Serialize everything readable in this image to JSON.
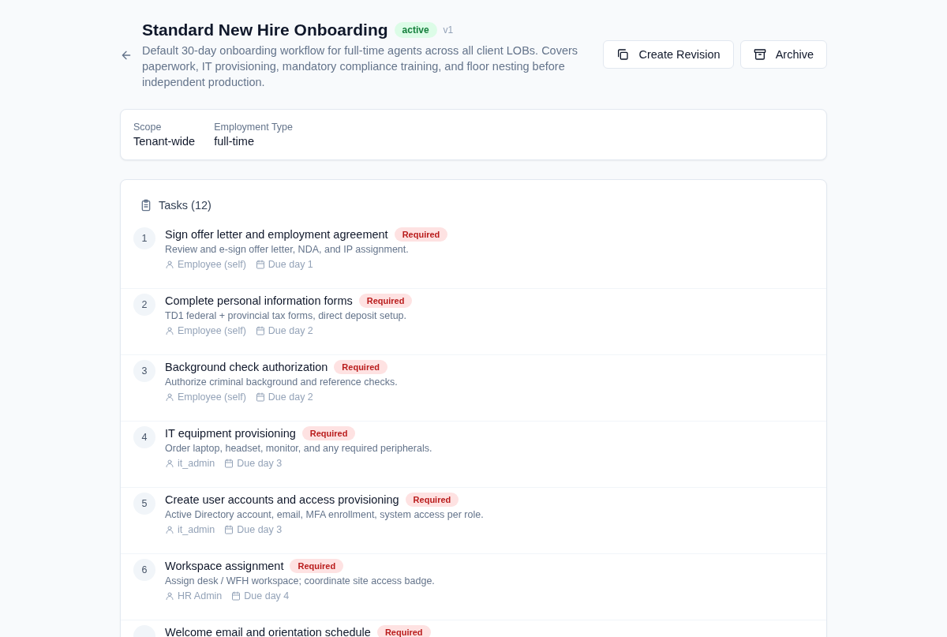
{
  "header": {
    "title": "Standard New Hire Onboarding",
    "status": "active",
    "version": "v1",
    "description": "Default 30-day onboarding workflow for full-time agents across all client LOBs. Covers paperwork, IT provisioning, mandatory compliance training, and floor nesting before independent production."
  },
  "actions": [
    {
      "label": "Create Revision",
      "kind": "copy"
    },
    {
      "label": "Archive",
      "kind": "archive"
    }
  ],
  "details": [
    {
      "label": "Scope",
      "value": "Tenant-wide"
    },
    {
      "label": "Employment Type",
      "value": "full-time"
    }
  ],
  "tasks": {
    "heading": "Tasks (12)",
    "items": [
      {
        "number": "1",
        "title": "Sign offer letter and employment agreement",
        "badge": "Required",
        "description": "Review and e-sign offer letter, NDA, and IP assignment.",
        "assignee": "Employee (self)",
        "due": "Due day 1"
      },
      {
        "number": "2",
        "title": "Complete personal information forms",
        "badge": "Required",
        "description": "TD1 federal + provincial tax forms, direct deposit setup.",
        "assignee": "Employee (self)",
        "due": "Due day 2"
      },
      {
        "number": "3",
        "title": "Background check authorization",
        "badge": "Required",
        "description": "Authorize criminal background and reference checks.",
        "assignee": "Employee (self)",
        "due": "Due day 2"
      },
      {
        "number": "4",
        "title": "IT equipment provisioning",
        "badge": "Required",
        "description": "Order laptop, headset, monitor, and any required peripherals.",
        "assignee": "it_admin",
        "due": "Due day 3"
      },
      {
        "number": "5",
        "title": "Create user accounts and access provisioning",
        "badge": "Required",
        "description": "Active Directory account, email, MFA enrollment, system access per role.",
        "assignee": "it_admin",
        "due": "Due day 3"
      },
      {
        "number": "6",
        "title": "Workspace assignment",
        "badge": "Required",
        "description": "Assign desk / WFH workspace; coordinate site access badge.",
        "assignee": "HR Admin",
        "due": "Due day 4"
      },
      {
        "title": "Welcome email and orientation schedule",
        "badge": "Required"
      }
    ]
  }
}
